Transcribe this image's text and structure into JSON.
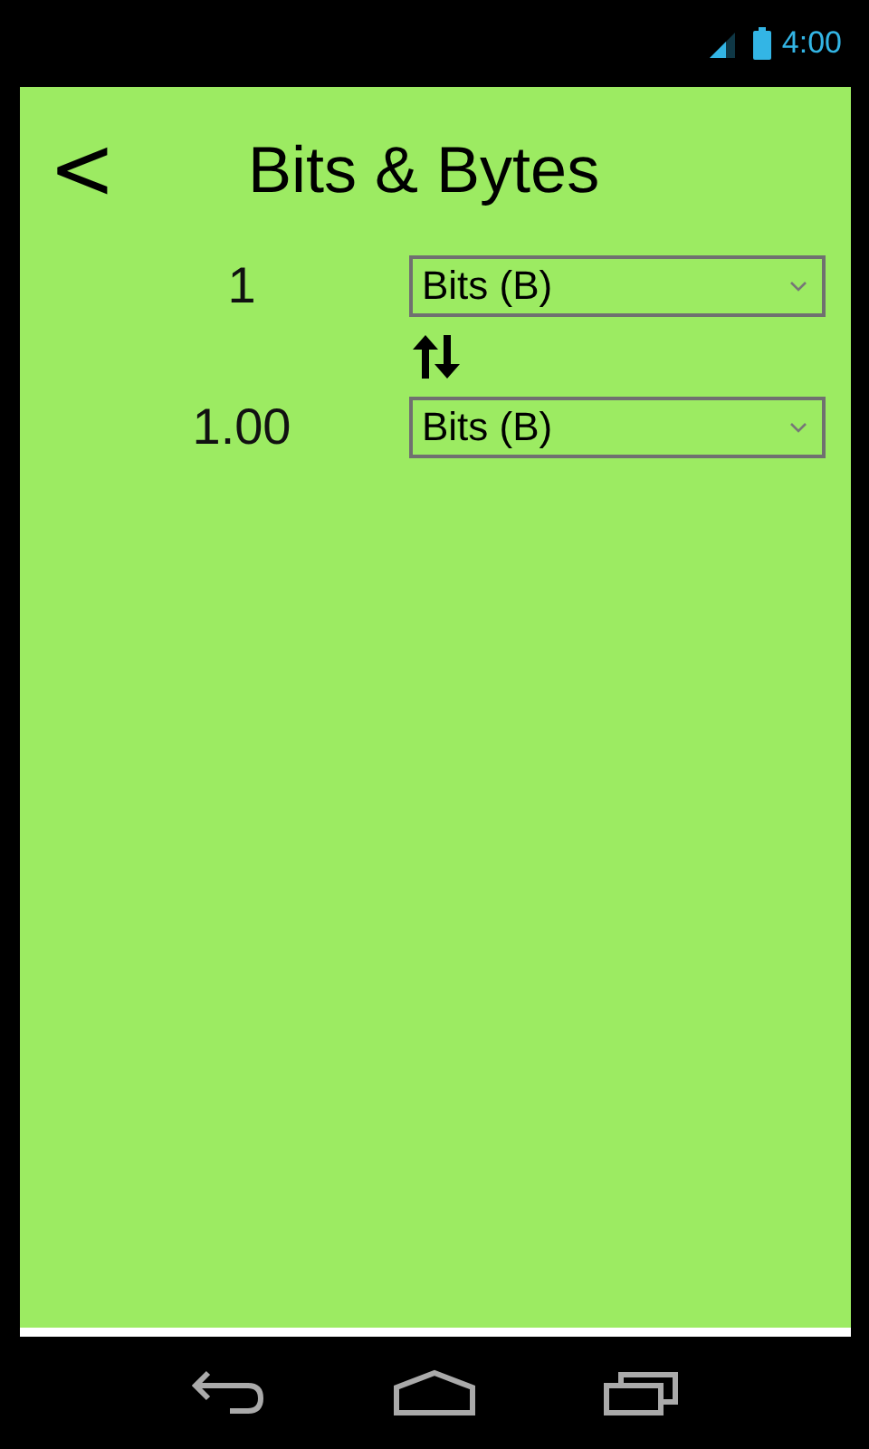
{
  "status_bar": {
    "time": "4:00"
  },
  "header": {
    "back": "<",
    "title": "Bits & Bytes"
  },
  "converter": {
    "rows": [
      {
        "value": "1",
        "unit": "Bits (B)"
      },
      {
        "value": "1.00",
        "unit": "Bits (B)"
      }
    ]
  }
}
